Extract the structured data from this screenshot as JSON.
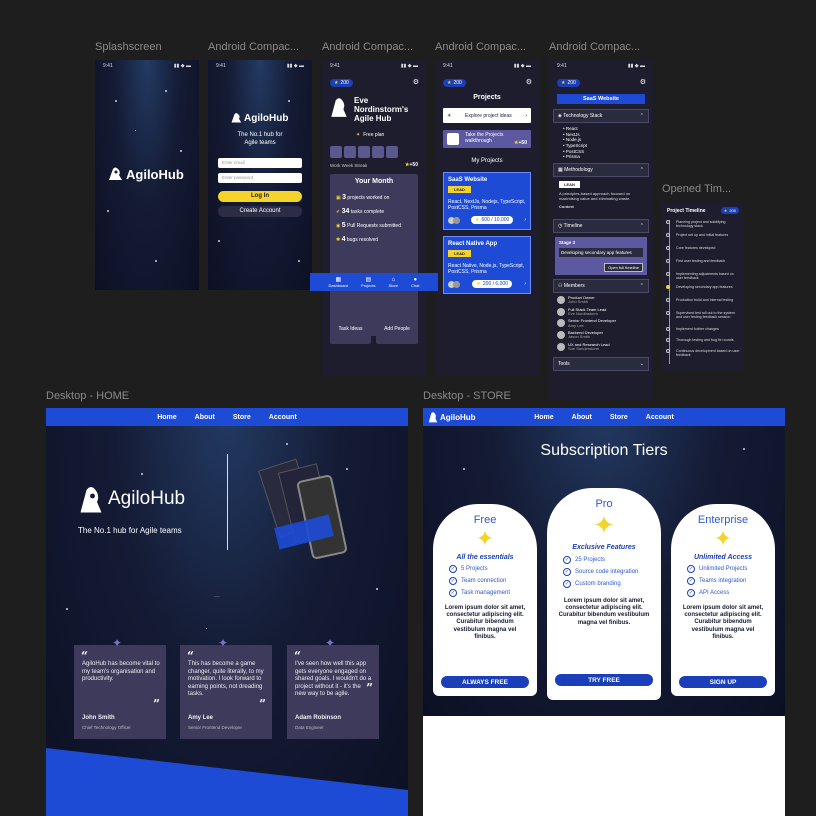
{
  "labels": {
    "splash": "Splashscreen",
    "android1": "Android Compac...",
    "android2": "Android Compac...",
    "android3": "Android Compac...",
    "android4": "Android Compac...",
    "timeline": "Opened Tim...",
    "desktop_home": "Desktop - HOME",
    "desktop_store": "Desktop - STORE"
  },
  "status": {
    "time": "9:41",
    "icons": "▮▮ ◆ ▬"
  },
  "brand": {
    "name": "AgiloHub",
    "tagline_mobile": "The No.1 hub for Agile teams",
    "tagline_desktop": "The No.1 hub for Agile teams"
  },
  "login": {
    "email_placeholder": "Enter email",
    "password_placeholder": "Enter password",
    "login_label": "Log In",
    "create_label": "Create Account"
  },
  "dashboard": {
    "points": "200",
    "title": "Eve Nordinstorm's Agile Hub",
    "plan": "Free plan",
    "streak_label": "Work Week Streak",
    "streak_points": "+50",
    "month_title": "Your Month",
    "stats": [
      {
        "num": "3",
        "text": "projects worked on"
      },
      {
        "num": "34",
        "text": "tasks complete"
      },
      {
        "num": "5",
        "text": "Pull Requests submitted"
      },
      {
        "num": "4",
        "text": "bugs resolved"
      }
    ],
    "tabs": [
      "Dashboard",
      "Projects",
      "Store",
      "Chat"
    ],
    "tiles": [
      {
        "label": "Task Ideas"
      },
      {
        "label": "Add People"
      }
    ]
  },
  "projects": {
    "points": "200",
    "title": "Projects",
    "explore": "Explore project ideas",
    "walkthrough": "Take the Projects walkthrough",
    "walk_points": "+50",
    "my_projects": "My Projects",
    "items": [
      {
        "name": "SaaS Website",
        "badge": "LEAD",
        "tech": "React, NextJs, Nodejs, TypeScript, PostCSS, Prisma",
        "progress": "600 / 10,000"
      },
      {
        "name": "React Native App",
        "badge": "LEAD",
        "tech": "React Native, Node.js, TypeScript, PostCSS, Prisma",
        "progress": "200 / 6,000"
      }
    ]
  },
  "project_detail": {
    "points": "200",
    "title": "SaaS Website",
    "sections": [
      "Technology Stack",
      "Methodology",
      "Timeline",
      "Members",
      "Tools"
    ],
    "tech": [
      "React",
      "NextJs",
      "Node.js",
      "TypeScript",
      "PostCSS",
      "Prisma"
    ],
    "method_tag": "LEAN",
    "method_text": "A principles-based approach focused on maximising value and eliminating waste.",
    "context_label": "Context",
    "stage": "Stage 3",
    "stage_text": "Developing secondary app features",
    "timeline_btn": "Open full timeline",
    "members": [
      {
        "name": "Product Owner",
        "person": "John Smith"
      },
      {
        "name": "Full Stack Team Lead",
        "person": "Eve Nordinstorm"
      },
      {
        "name": "Senior Frontend Developer",
        "person": "Amy Lee"
      },
      {
        "name": "Backend Developer",
        "person": "Jason Smith"
      },
      {
        "name": "UX and Research Lead",
        "person": "Sue Sunderstorm"
      }
    ]
  },
  "timeline_panel": {
    "title": "Project Timeline",
    "points": "200",
    "steps": [
      "Planning project and solidifying technology stack",
      "Project set up and initial features",
      "Core features developed",
      "First user testing and feedback",
      "Implementing adjustments based on user feedback",
      "Developing secondary app features",
      "Production build and internal testing",
      "Supervised test roll out to the system and user testing feedback session",
      "Implement further changes",
      "Thorough testing and bug fix rounds",
      "Continuous development based on user feedback"
    ]
  },
  "desktop_home": {
    "nav": [
      "Home",
      "About",
      "Store",
      "Account"
    ],
    "ellipsis": "...",
    "quotes": [
      {
        "text": "AgiloHub has become vital to my team's organisation and productivity.",
        "name": "John Smith",
        "role": "Chief Technology Officer"
      },
      {
        "text": "This has become a game changer, quite literally, to my motivation. I look forward to earning points, not dreading tasks.",
        "name": "Amy Lee",
        "role": "Senior Frontend Developer"
      },
      {
        "text": "I've seen how well this app gets everyone engaged on shared goals. I wouldn't do a project without it - it's the new way to be agile.",
        "name": "Adam Robinson",
        "role": "Data Engineer"
      }
    ]
  },
  "desktop_store": {
    "nav": [
      "Home",
      "About",
      "Store",
      "Account"
    ],
    "title": "Subscription Tiers",
    "lorem": "Lorem ipsum dolor sit amet, consectetur adipiscing elit. Curabitur bibendum vestibulum magna vel finibus.",
    "tiers": [
      {
        "name": "Free",
        "subtitle": "All the essentials",
        "features": [
          "5 Projects",
          "Team connection",
          "Task management"
        ],
        "cta": "ALWAYS FREE"
      },
      {
        "name": "Pro",
        "subtitle": "Exclusive Features",
        "features": [
          "25 Projects",
          "Source code integration",
          "Custom branding"
        ],
        "cta": "TRY FREE"
      },
      {
        "name": "Enterprise",
        "subtitle": "Unlimited Access",
        "features": [
          "Unlimited Projects",
          "Teams integration",
          "API Access"
        ],
        "cta": "SIGN UP"
      }
    ]
  },
  "colors": {
    "brand_blue": "#1d4bd6",
    "accent_yellow": "#f4d42b",
    "card_purple": "#3e3a5c",
    "canvas": "#1e1e1e"
  }
}
